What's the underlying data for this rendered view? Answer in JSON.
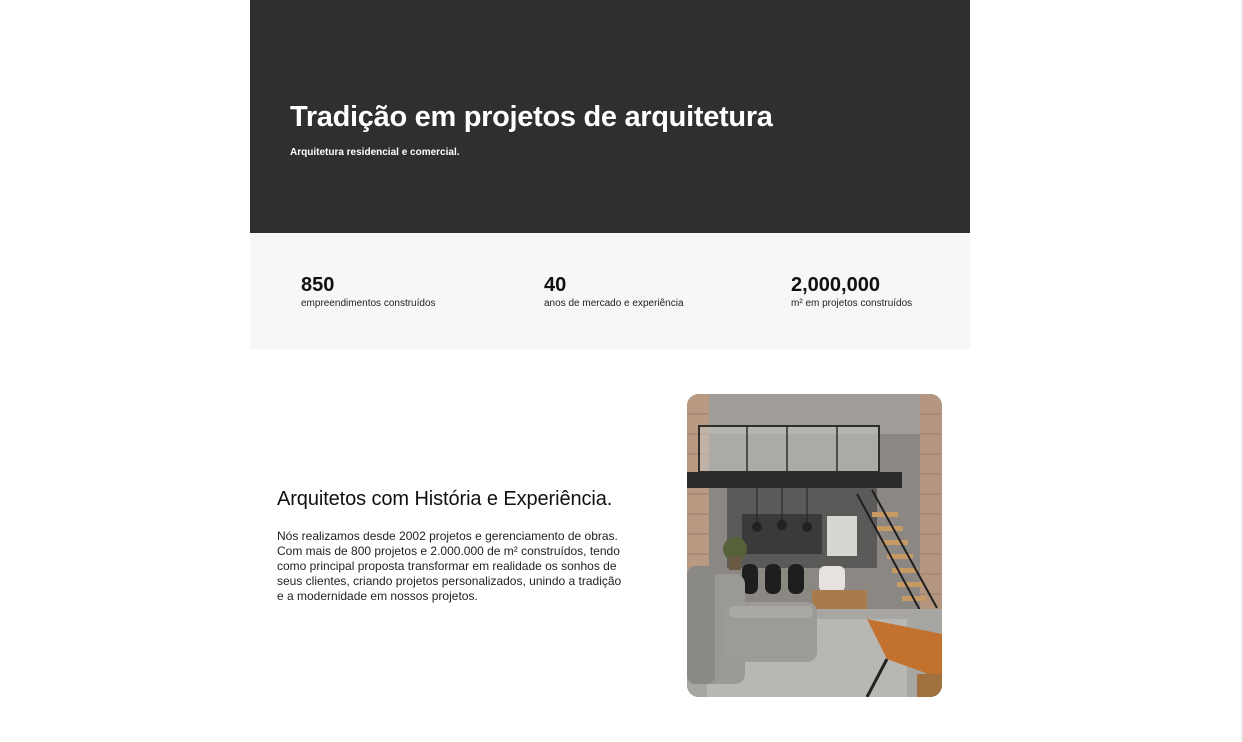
{
  "hero": {
    "title": "Tradição em projetos de arquitetura",
    "subtitle": "Arquitetura residencial e comercial."
  },
  "stats": [
    {
      "value": "850",
      "label": "empreendimentos construídos"
    },
    {
      "value": "40",
      "label": "anos de mercado e experiência"
    },
    {
      "value": "2,000,000",
      "label": "m² em projetos construídos"
    }
  ],
  "about": {
    "heading": "Arquitetos com História e Experiência.",
    "body": "Nós realizamos desde 2002 projetos e gerenciamento de obras. Com mais de 800 projetos e 2.000.000 de m² construídos, tendo como principal proposta transformar em realidade os sonhos de seus clientes, criando projetos personalizados, unindo a tradição e a modernidade em nossos projetos."
  },
  "colors": {
    "hero_background": "#2f2f2f",
    "stats_background": "#f7f7f7",
    "text_dark": "#111111"
  }
}
